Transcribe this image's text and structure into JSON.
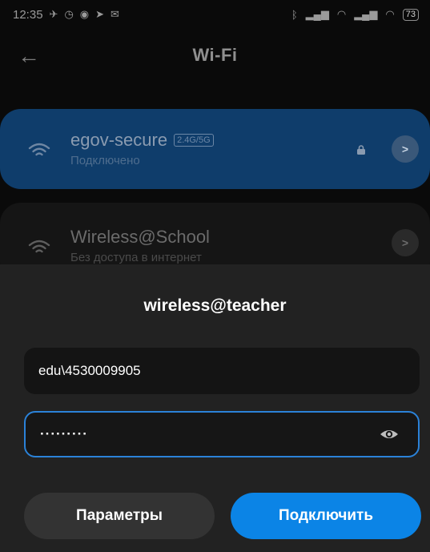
{
  "status_bar": {
    "time": "12:35",
    "battery": "73",
    "left_icons": [
      "alarm-off-icon",
      "alarm-icon",
      "record-icon",
      "send-icon",
      "mail-icon"
    ],
    "right_icons": [
      "bluetooth-icon",
      "signal-icon",
      "wifi-icon",
      "signal-icon",
      "wifi-icon"
    ]
  },
  "app_bar": {
    "title": "Wi-Fi"
  },
  "networks": [
    {
      "name": "egov-secure",
      "band": "2.4G/5G",
      "status": "Подключено",
      "secured": true
    },
    {
      "name": "Wireless@School",
      "status": "Без доступа в интернет"
    }
  ],
  "dialog": {
    "title": "wireless@teacher",
    "username_value": "edu\\4530009905",
    "password_value": "·········",
    "params_button": "Параметры",
    "connect_button": "Подключить"
  },
  "colors": {
    "accent": "#0b84e6",
    "connected_card": "#0f3d6b",
    "dialog_bg": "#222222"
  }
}
